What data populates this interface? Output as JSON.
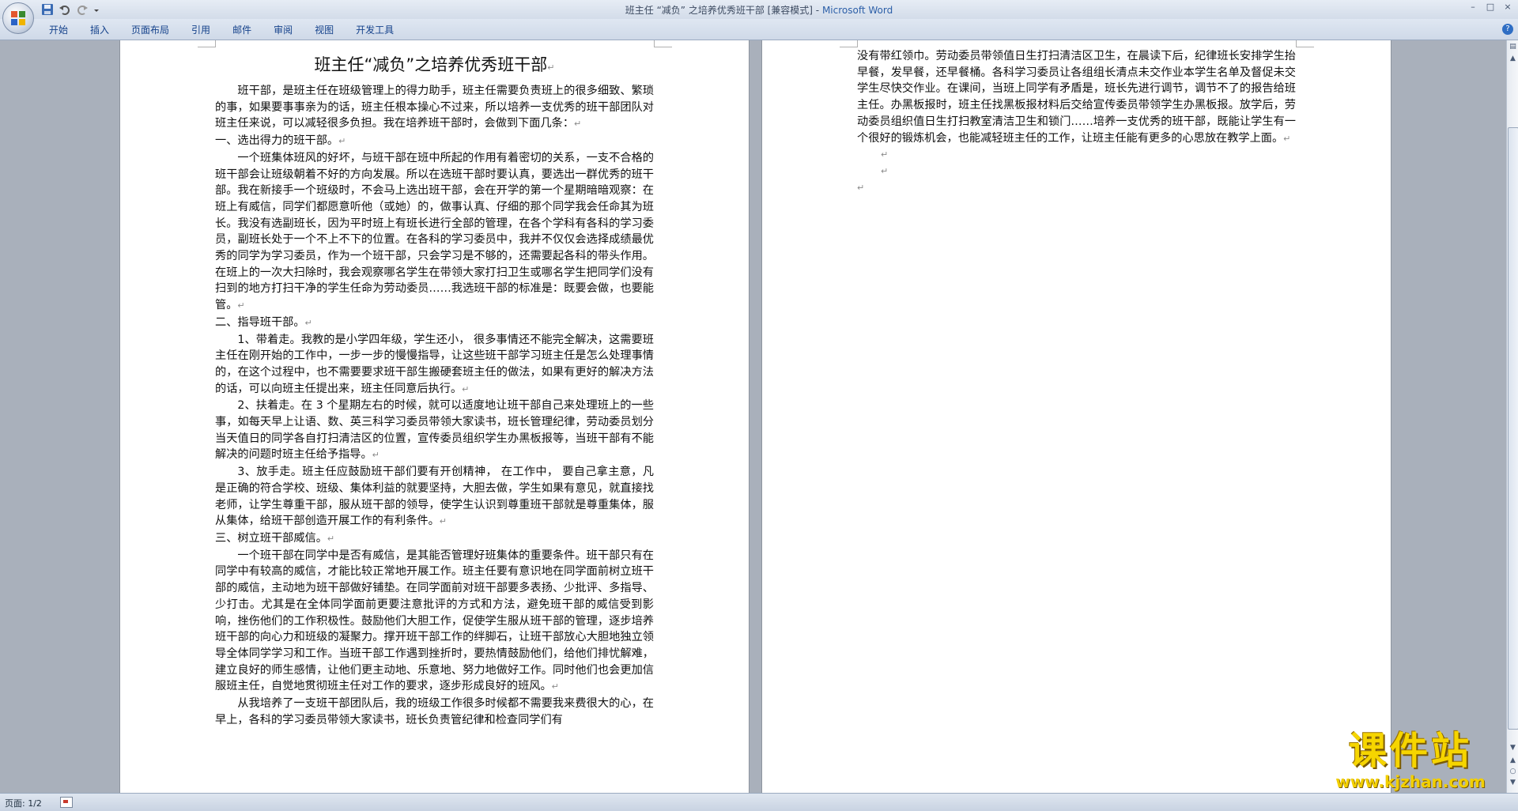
{
  "window": {
    "title_doc": "班主任 “减负” 之培养优秀班干部 [兼容模式] - ",
    "title_app": "Microsoft Word",
    "controls": [
      "–",
      "□",
      "×"
    ]
  },
  "quick_access": [
    "save-icon",
    "undo-icon",
    "redo-icon",
    "customize-icon"
  ],
  "ribbon": {
    "tabs": [
      "开始",
      "插入",
      "页面布局",
      "引用",
      "邮件",
      "审阅",
      "视图",
      "开发工具"
    ]
  },
  "page1": {
    "title": "班主任“减负”之培养优秀班干部",
    "para_intro": "班干部，是班主任在班级管理上的得力助手，班主任需要负责班上的很多细致、繁琐的事，如果要事事亲为的话，班主任根本操心不过来，所以培养一支优秀的班干部团队对班主任来说，可以减轻很多负担。我在培养班干部时，会做到下面几条：",
    "h1": "一、选出得力的班干部。",
    "para_1": "一个班集体班风的好坏，与班干部在班中所起的作用有着密切的关系，一支不合格的班干部会让班级朝着不好的方向发展。所以在选班干部时要认真，要选出一群优秀的班干部。我在新接手一个班级时，不会马上选出班干部，会在开学的第一个星期暗暗观察：在班上有威信，同学们都愿意听他（或她）的，做事认真、仔细的那个同学我会任命其为班长。我没有选副班长，因为平时班上有班长进行全部的管理，在各个学科有各科的学习委员，副班长处于一个不上不下的位置。在各科的学习委员中，我并不仅仅会选择成绩最优秀的同学为学习委员，作为一个班干部，只会学习是不够的，还需要起各科的带头作用。在班上的一次大扫除时，我会观察哪名学生在带领大家打扫卫生或哪名学生把同学们没有扫到的地方打扫干净的学生任命为劳动委员……我选班干部的标准是：既要会做，也要能管。",
    "h2": "二、指导班干部。",
    "para_2a": "1、带着走。我教的是小学四年级，学生还小， 很多事情还不能完全解决，这需要班主任在刚开始的工作中，一步一步的慢慢指导，让这些班干部学习班主任是怎么处理事情的，在这个过程中，也不需要要求班干部生搬硬套班主任的做法，如果有更好的解决方法的话，可以向班主任提出来，班主任同意后执行。",
    "para_2b": "2、扶着走。在 3 个星期左右的时候，就可以适度地让班干部自己来处理班上的一些事，如每天早上让语、数、英三科学习委员带领大家读书，班长管理纪律，劳动委员划分当天值日的同学各自打扫清洁区的位置，宣传委员组织学生办黑板报等，当班干部有不能解决的问题时班主任给予指导。",
    "para_2c": "3、放手走。班主任应鼓励班干部们要有开创精神， 在工作中， 要自己拿主意，凡是正确的符合学校、班级、集体利益的就要坚持，大胆去做，学生如果有意见，就直接找老师，让学生尊重干部，服从班干部的领导，使学生认识到尊重班干部就是尊重集体，服从集体，给班干部创造开展工作的有利条件。",
    "h3": "三、树立班干部威信。",
    "para_3": "一个班干部在同学中是否有威信，是其能否管理好班集体的重要条件。班干部只有在同学中有较高的威信，才能比较正常地开展工作。班主任要有意识地在同学面前树立班干部的威信，主动地为班干部做好铺垫。在同学面前对班干部要多表扬、少批评、多指导、少打击。尤其是在全体同学面前更要注意批评的方式和方法，避免班干部的威信受到影响，挫伤他们的工作积极性。鼓励他们大胆工作，促使学生服从班干部的管理，逐步培养班干部的向心力和班级的凝聚力。撑开班干部工作的绊脚石，让班干部放心大胆地独立领导全体同学学习和工作。当班干部工作遇到挫折时，要热情鼓励他们，给他们排忧解难，建立良好的师生感情，让他们更主动地、乐意地、努力地做好工作。同时他们也会更加信服班主任，自觉地贯彻班主任对工作的要求，逐步形成良好的班风。",
    "para_4": "从我培养了一支班干部团队后，我的班级工作很多时候都不需要我来费很大的心，在早上，各科的学习委员带领大家读书，班长负责管纪律和检查同学们有"
  },
  "page2": {
    "para_cont": "没有带红领巾。劳动委员带领值日生打扫清洁区卫生，在晨读下后，纪律班长安排学生抬早餐，发早餐，还早餐桶。各科学习委员让各组组长清点未交作业本学生名单及督促未交学生尽快交作业。在课间，当班上同学有矛盾是，班长先进行调节，调节不了的报告给班主任。办黑板报时，班主任找黑板报材料后交给宣传委员带领学生办黑板报。放学后，劳动委员组织值日生打扫教室清洁卫生和锁门……培养一支优秀的班干部，既能让学生有一个很好的锻炼机会，也能减轻班主任的工作，让班主任能有更多的心思放在教学上面。",
    "para_mark": "↵"
  },
  "status": {
    "page_info": "页面: 1/2"
  },
  "watermark": {
    "cn": "课件站",
    "url": "www.kjzhan.com"
  },
  "colors": {
    "workspace": "#a9b0bb",
    "ribbon_text": "#15428b",
    "watermark": "#f6d500"
  }
}
